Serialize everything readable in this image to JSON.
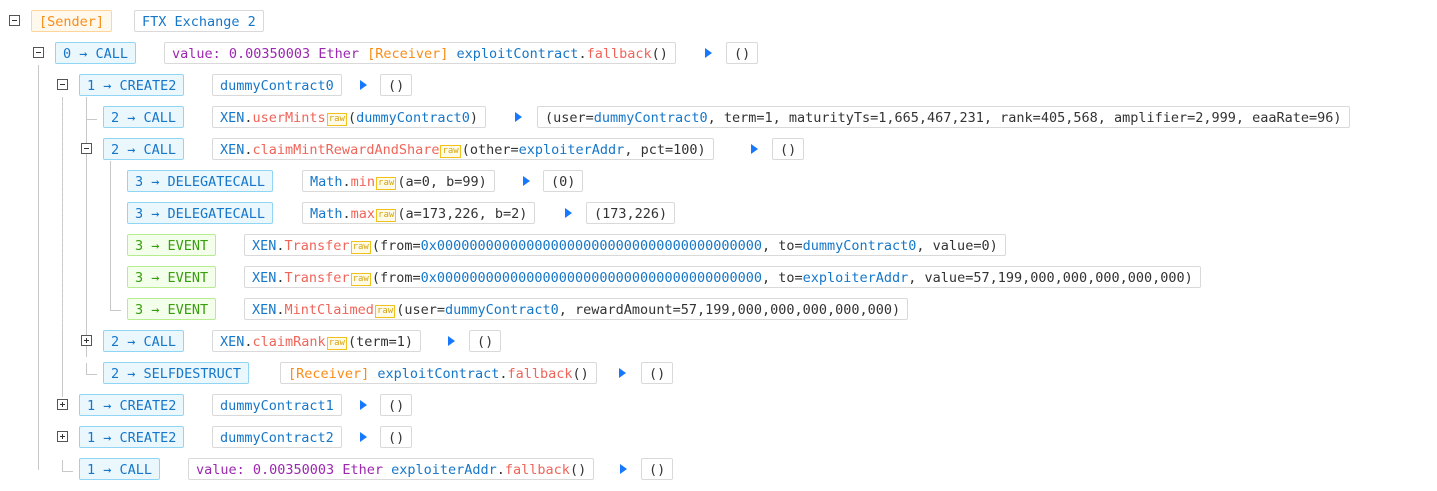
{
  "root": {
    "sender_tag": "[Sender]",
    "name": "FTX Exchange 2"
  },
  "labels": {
    "receiver": "[Receiver]",
    "raw": "raw",
    "value_prefix": "value: ",
    "ether": " Ether ",
    "empty": "()"
  },
  "n0": {
    "op": "0 → CALL",
    "value": "0.00350003",
    "contract": "exploitContract",
    "fn": "fallback"
  },
  "n1": {
    "op": "1 → CREATE2",
    "target": "dummyContract0",
    "out": "()"
  },
  "n2": {
    "op": "2 → CALL",
    "contract": "XEN",
    "fn": "userMints",
    "args": "dummyContract0",
    "out_prefix": "(user=",
    "out_user": "dummyContract0",
    "out_rest": ", term=1, maturityTs=1,665,467,231, rank=405,568, amplifier=2,999, eaaRate=96)"
  },
  "n3": {
    "op": "2 → CALL",
    "contract": "XEN",
    "fn": "claimMintRewardAndShare",
    "arg_prefix": "(other=",
    "arg_addr": "exploiterAddr",
    "arg_rest": ", pct=100)",
    "out": "()"
  },
  "n4": {
    "op": "3 → DELEGATECALL",
    "contract": "Math",
    "fn": "min",
    "args": "(a=0, b=99)",
    "out": "(0)"
  },
  "n5": {
    "op": "3 → DELEGATECALL",
    "contract": "Math",
    "fn": "max",
    "args": "(a=173,226, b=2)",
    "out": "(173,226)"
  },
  "n6": {
    "op": "3 → EVENT",
    "contract": "XEN",
    "fn": "Transfer",
    "from": "0x0000000000000000000000000000000000000000",
    "to": "dummyContract0",
    "value": "0"
  },
  "n7": {
    "op": "3 → EVENT",
    "contract": "XEN",
    "fn": "Transfer",
    "from": "0x0000000000000000000000000000000000000000",
    "to": "exploiterAddr",
    "value": "57,199,000,000,000,000,000"
  },
  "n8": {
    "op": "3 → EVENT",
    "contract": "XEN",
    "fn": "MintClaimed",
    "user": "dummyContract0",
    "reward": "57,199,000,000,000,000,000"
  },
  "n9": {
    "op": "2 → CALL",
    "contract": "XEN",
    "fn": "claimRank",
    "args": "(term=1)",
    "out": "()"
  },
  "n10": {
    "op": "2 → SELFDESTRUCT",
    "contract": "exploitContract",
    "fn": "fallback",
    "out": "()"
  },
  "n11": {
    "op": "1 → CREATE2",
    "target": "dummyContract1",
    "out": "()"
  },
  "n12": {
    "op": "1 → CREATE2",
    "target": "dummyContract2",
    "out": "()"
  },
  "n13": {
    "op": "1 → CALL",
    "value": "0.00350003",
    "contract": "exploiterAddr",
    "fn": "fallback",
    "out": "()"
  }
}
